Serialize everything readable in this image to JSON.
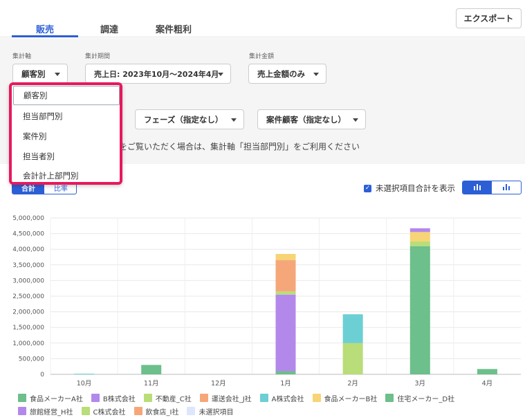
{
  "tabs": [
    {
      "label": "販売",
      "active": true
    },
    {
      "label": "調達",
      "active": false
    },
    {
      "label": "案件粗利",
      "active": false
    }
  ],
  "export_label": "エクスポート",
  "filters": {
    "axis_label": "集計軸",
    "axis_value": "顧客別",
    "period_label": "集計期間",
    "period_value": "売上日: 2023年10月〜2024年4月",
    "amount_label": "集計金額",
    "amount_value": "売上金額のみ",
    "phase_value": "フェーズ（指定なし）",
    "customer_value": "案件顧客（指定なし）",
    "note": "をご覧いただく場合は、集計軸「担当部門別」をご利用ください"
  },
  "dropdown": {
    "options": [
      "顧客別",
      "担当部門別",
      "案件別",
      "担当者別",
      "会計計上部門別"
    ],
    "selected_index": 0
  },
  "toggle": {
    "left": "合計",
    "right": "比率"
  },
  "show_unselected_label": "未選択項目合計を表示",
  "show_unselected_checked": true,
  "icons": {
    "view_stacked": "bar-chart-stacked-icon",
    "view_grouped": "bar-chart-icon"
  },
  "colors": {
    "accent": "#2c5fd6",
    "highlight": "#e8185c"
  },
  "chart_data": {
    "type": "bar",
    "stacked": true,
    "categories": [
      "10月",
      "11月",
      "12月",
      "1月",
      "2月",
      "3月",
      "4月"
    ],
    "ylim": [
      0,
      5000000
    ],
    "yticks": [
      "0",
      "500,000",
      "1,000,000",
      "1,500,000",
      "2,000,000",
      "2,500,000",
      "3,000,000",
      "3,500,000",
      "4,000,000",
      "4,500,000",
      "5,000,000"
    ],
    "series": [
      {
        "name": "食品メーカーA社",
        "color": "#6dbf8b",
        "values": [
          0,
          300000,
          0,
          100000,
          0,
          0,
          0
        ]
      },
      {
        "name": "B株式会社",
        "color": "#b388eb",
        "values": [
          0,
          0,
          0,
          2450000,
          0,
          0,
          0
        ]
      },
      {
        "name": "不動産_C社",
        "color": "#b9dd78",
        "values": [
          0,
          0,
          0,
          0,
          1000000,
          0,
          0
        ]
      },
      {
        "name": "運送会社_J社",
        "color": "#f5a77a",
        "values": [
          0,
          0,
          0,
          1000000,
          0,
          0,
          0
        ]
      },
      {
        "name": "A株式会社",
        "color": "#6ccfd3",
        "values": [
          20000,
          0,
          0,
          0,
          920000,
          0,
          0
        ]
      },
      {
        "name": "食品メーカーB社",
        "color": "#f7d475",
        "values": [
          0,
          0,
          0,
          200000,
          0,
          300000,
          0
        ]
      },
      {
        "name": "住宅メーカー_D社",
        "color": "#6dbf8b",
        "values": [
          0,
          0,
          0,
          0,
          0,
          4100000,
          170000
        ]
      },
      {
        "name": "旅館経営_H社",
        "color": "#b388eb",
        "values": [
          0,
          0,
          0,
          0,
          0,
          120000,
          0
        ]
      },
      {
        "name": "C株式会社",
        "color": "#b9dd78",
        "values": [
          0,
          0,
          0,
          100000,
          0,
          150000,
          0
        ]
      },
      {
        "name": "飲食店_I社",
        "color": "#f5a77a",
        "values": [
          0,
          0,
          0,
          0,
          0,
          0,
          0
        ]
      },
      {
        "name": "未選択項目",
        "color": "#dde6fb",
        "values": [
          0,
          0,
          0,
          0,
          0,
          0,
          0
        ]
      }
    ],
    "stack_order": [
      "食品メーカーA社",
      "住宅メーカー_D社",
      "B株式会社",
      "C株式会社",
      "不動産_C社",
      "運送会社_J社",
      "A株式会社",
      "食品メーカーB社",
      "旅館経営_H社"
    ],
    "grid": true,
    "legend_position": "bottom"
  }
}
